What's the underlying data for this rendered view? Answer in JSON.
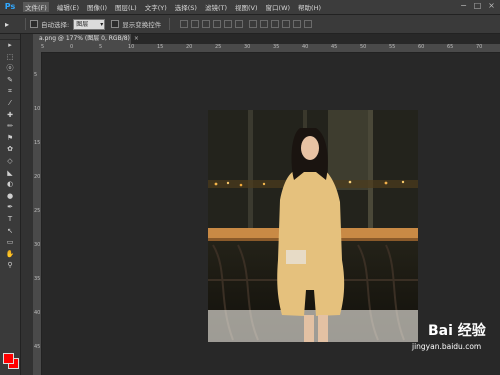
{
  "menubar": {
    "app_icon": "Ps",
    "items": [
      "文件(F)",
      "编辑(E)",
      "图像(I)",
      "图层(L)",
      "文字(Y)",
      "选择(S)",
      "滤镜(T)",
      "视图(V)",
      "窗口(W)",
      "帮助(H)"
    ],
    "window_controls": [
      "−",
      "□",
      "×"
    ]
  },
  "options_bar": {
    "tool_glyph": "▸",
    "auto_select_label": "自动选择:",
    "auto_select_value": "图层",
    "show_transform_label": "显示变换控件"
  },
  "document": {
    "tab_label": "a.png @ 177% (图层 0, RGB/8)",
    "close": "×"
  },
  "ruler": {
    "top_ticks": [
      "5",
      "0",
      "5",
      "10",
      "15",
      "20",
      "25",
      "30",
      "35",
      "40",
      "45",
      "50",
      "55",
      "60",
      "65",
      "70"
    ],
    "left_ticks": [
      "5",
      "10",
      "15",
      "20",
      "25",
      "30",
      "35",
      "40",
      "45"
    ]
  },
  "tools": [
    {
      "glyph": "▸",
      "name": "move-tool-icon"
    },
    {
      "glyph": "⬚",
      "name": "marquee-tool-icon"
    },
    {
      "glyph": "ⓞ",
      "name": "lasso-tool-icon"
    },
    {
      "glyph": "✎",
      "name": "quick-select-tool-icon"
    },
    {
      "glyph": "⌗",
      "name": "crop-tool-icon"
    },
    {
      "glyph": "⁄",
      "name": "eyedropper-tool-icon"
    },
    {
      "glyph": "✚",
      "name": "healing-tool-icon"
    },
    {
      "glyph": "✏",
      "name": "brush-tool-icon"
    },
    {
      "glyph": "⚑",
      "name": "clone-stamp-tool-icon"
    },
    {
      "glyph": "✿",
      "name": "history-brush-tool-icon"
    },
    {
      "glyph": "◇",
      "name": "eraser-tool-icon"
    },
    {
      "glyph": "◣",
      "name": "paint-bucket-tool-icon"
    },
    {
      "glyph": "◐",
      "name": "blur-tool-icon"
    },
    {
      "glyph": "●",
      "name": "dodge-tool-icon"
    },
    {
      "glyph": "✒",
      "name": "pen-tool-icon"
    },
    {
      "glyph": "T",
      "name": "type-tool-icon"
    },
    {
      "glyph": "↖",
      "name": "path-select-tool-icon"
    },
    {
      "glyph": "▭",
      "name": "shape-tool-icon"
    },
    {
      "glyph": "✋",
      "name": "hand-tool-icon"
    },
    {
      "glyph": "⚲",
      "name": "zoom-tool-icon"
    }
  ],
  "swatches": {
    "foreground": "#ff0000",
    "background": "#ff0000"
  },
  "watermark": {
    "brand": "Bai 经验",
    "url": "jingyan.baidu.com"
  }
}
